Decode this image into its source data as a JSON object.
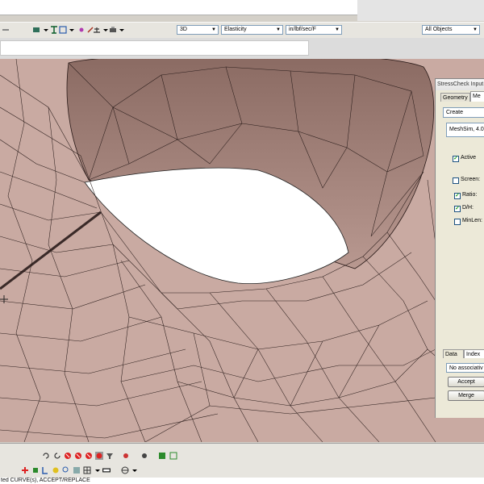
{
  "toolbar": {
    "view_mode": "3D",
    "analysis_type": "Elasticity",
    "units": "in/lbf/sec/F",
    "filter": "All Objects"
  },
  "command_input": {
    "value": ""
  },
  "panel": {
    "title": "StressCheck Input",
    "tabs": [
      "Geometry",
      "Me"
    ],
    "action": "Create",
    "mesher": "MeshSim, 4.0",
    "options": [
      {
        "label": "Active",
        "checked": true
      },
      {
        "label": "Screen:",
        "checked": false
      },
      {
        "label": "Ratio:",
        "checked": true
      },
      {
        "label": "D/H:",
        "checked": true
      },
      {
        "label": "MinLen:",
        "checked": false
      }
    ],
    "bottom_tabs": [
      "Data",
      "Index"
    ],
    "association": "No associativ",
    "accept_label": "Accept",
    "merge_label": "Merge"
  },
  "status": {
    "text": "ted CURVE(s), ACCEPT/REPLACE"
  }
}
